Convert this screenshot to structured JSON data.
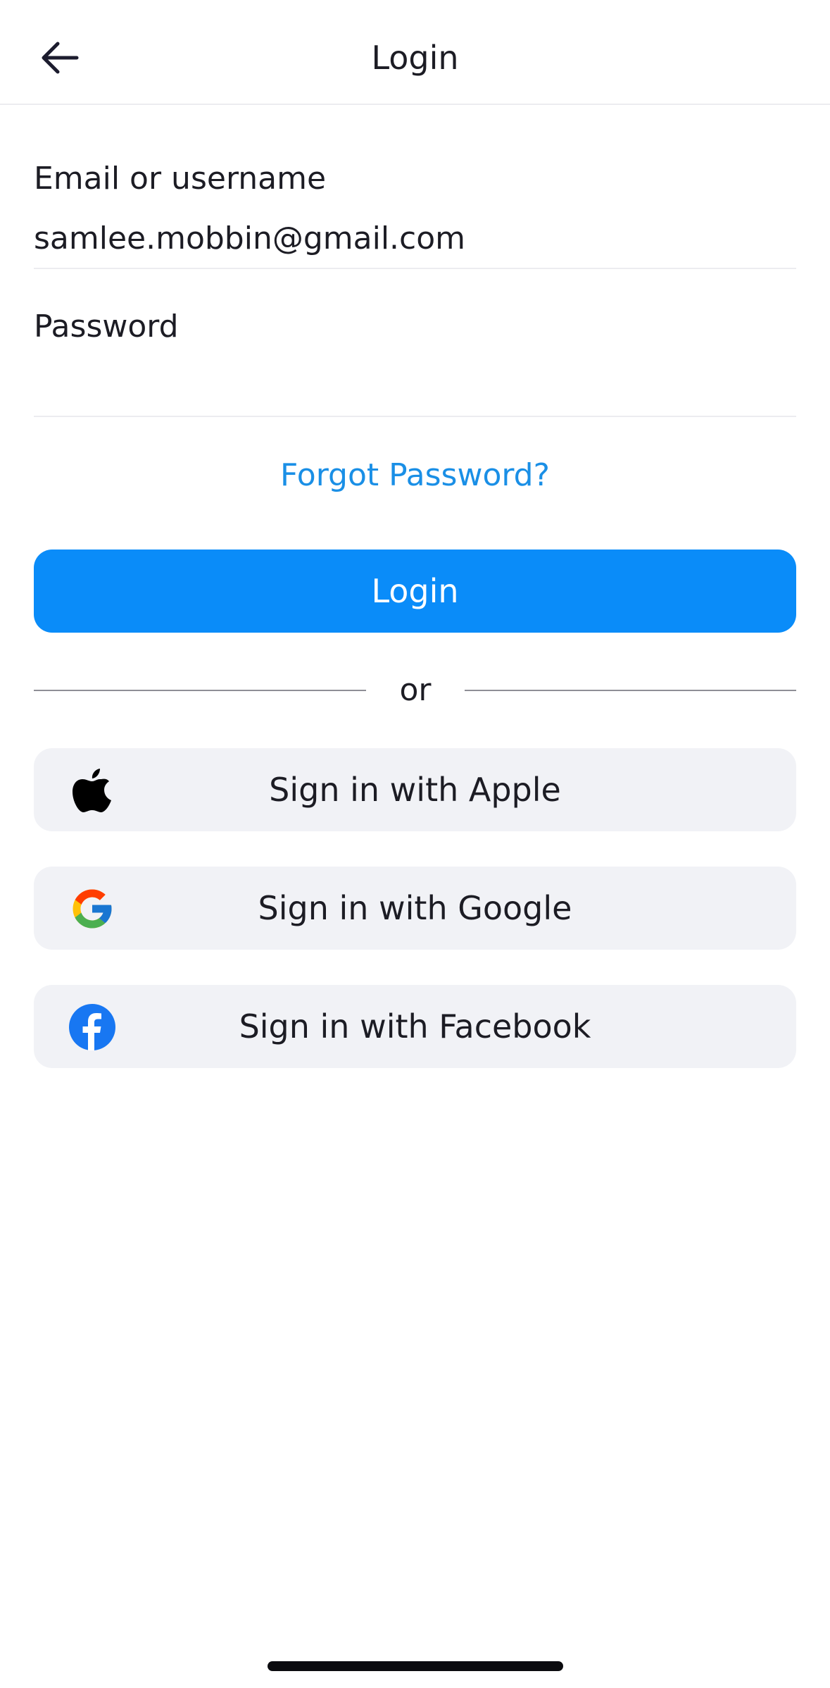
{
  "header": {
    "title": "Login",
    "back_icon": "arrow-left-icon"
  },
  "form": {
    "email": {
      "label": "Email or username",
      "value": "samlee.mobbin@gmail.com"
    },
    "password": {
      "label": "Password",
      "value": ""
    },
    "forgot_password": "Forgot Password?",
    "login_button": "Login"
  },
  "divider": {
    "text": "or"
  },
  "social": {
    "apple": {
      "label": "Sign in with Apple",
      "icon": "apple-icon"
    },
    "google": {
      "label": "Sign in with Google",
      "icon": "google-icon"
    },
    "facebook": {
      "label": "Sign in with Facebook",
      "icon": "facebook-icon"
    }
  },
  "colors": {
    "accent": "#0a8cf9",
    "link": "#1a8fe6",
    "social_bg": "#f1f2f6",
    "facebook": "#1877f2"
  }
}
